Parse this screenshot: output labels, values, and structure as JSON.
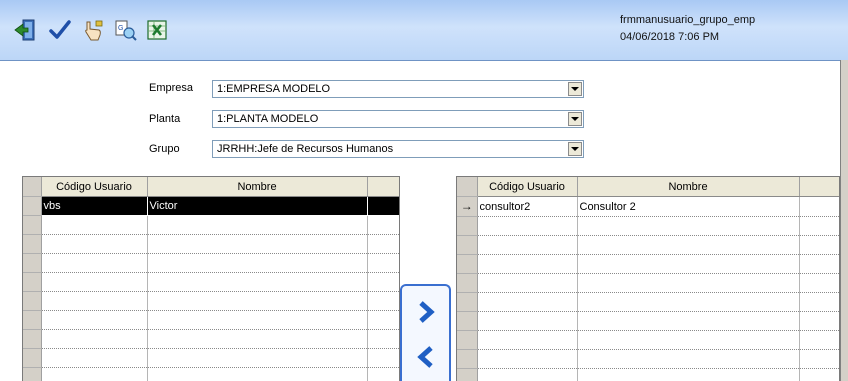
{
  "header": {
    "form_name": "frmmanusuario_grupo_emp",
    "datetime": "04/06/2018 7:06 PM",
    "toolbar": [
      {
        "name": "exit-icon"
      },
      {
        "name": "confirm-checkmark-icon"
      },
      {
        "name": "pointer-hand-icon"
      },
      {
        "name": "print-preview-icon"
      },
      {
        "name": "excel-export-icon"
      }
    ]
  },
  "filters": {
    "empresa": {
      "label": "Empresa",
      "value": "1:EMPRESA MODELO"
    },
    "planta": {
      "label": "Planta",
      "value": "1:PLANTA MODELO"
    },
    "grupo": {
      "label": "Grupo",
      "value": "JRRHH:Jefe de Recursos Humanos"
    }
  },
  "left_grid": {
    "columns": [
      "Código Usuario",
      "Nombre"
    ],
    "rows": [
      {
        "code": "vbs",
        "name": "Victor"
      }
    ]
  },
  "right_grid": {
    "columns": [
      "Código Usuario",
      "Nombre"
    ],
    "rows": [
      {
        "code": "consultor2",
        "name": "Consultor 2",
        "indicator": "→"
      }
    ]
  },
  "colors": {
    "header_top": "#a9c9f4",
    "header_bottom": "#bcd6f7",
    "selected_row": "#000000",
    "accent_button": "#1f5fc4"
  }
}
